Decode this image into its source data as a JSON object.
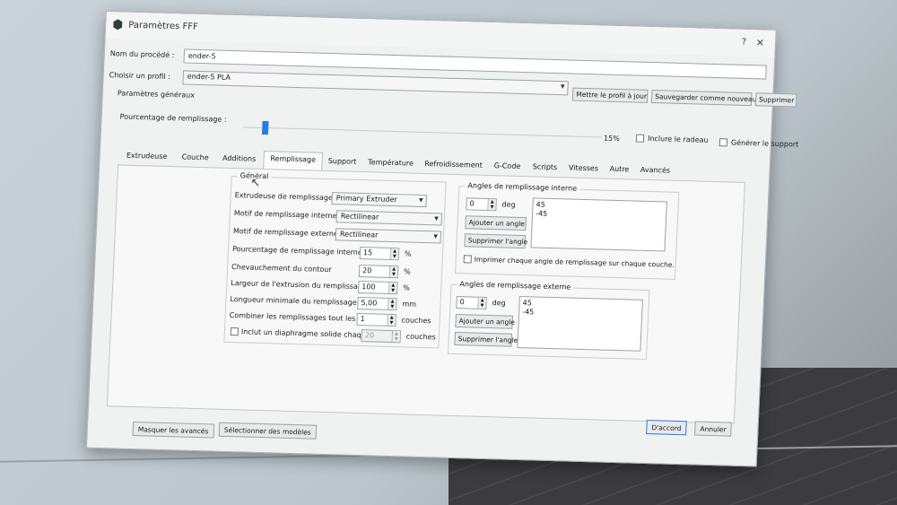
{
  "window": {
    "title": "Paramètres FFF",
    "help": "?",
    "close": "✕"
  },
  "process": {
    "label": "Nom du procédé :",
    "value": "ender-5"
  },
  "profile": {
    "label": "Choisir un profil :",
    "value": "ender-5 PLA",
    "update_btn": "Mettre le profil à jour",
    "save_new_btn": "Sauvegarder comme nouveau",
    "delete_btn": "Supprimer"
  },
  "general": {
    "title": "Paramètres généraux",
    "infill_label": "Pourcentage de remplissage :",
    "infill_value_text": "15%",
    "infill_fraction": 0.15,
    "raft_label": "Inclure le radeau",
    "support_label": "Générer le support"
  },
  "tabs": [
    "Extrudeuse",
    "Couche",
    "Additions",
    "Remplissage",
    "Support",
    "Température",
    "Refroidissement",
    "G-Code",
    "Scripts",
    "Vitesses",
    "Autre",
    "Avancés"
  ],
  "active_tab": "Remplissage",
  "infill": {
    "group_title": "Général",
    "extruder_label": "Extrudeuse de remplissage",
    "extruder_value": "Primary Extruder",
    "internal_pattern_label": "Motif de remplissage interne",
    "internal_pattern_value": "Rectilinear",
    "external_pattern_label": "Motif de remplissage externe",
    "external_pattern_value": "Rectilinear",
    "internal_pct_label": "Pourcentage de remplissage interne",
    "internal_pct_value": "15",
    "overlap_label": "Chevauchement du contour",
    "overlap_value": "20",
    "width_label": "Largeur de l'extrusion du remplissage",
    "width_value": "100",
    "min_length_label": "Longueur minimale du remplissage",
    "min_length_value": "5,00",
    "combine_label": "Combiner les remplissages tout les",
    "combine_value": "1",
    "diaphragm_label": "Inclut un diaphragme solide chaque",
    "diaphragm_value": "20",
    "unit_pct": "%",
    "unit_mm": "mm",
    "unit_layers": "couches"
  },
  "internal_angles": {
    "title": "Angles de remplissage interne",
    "value": "0",
    "unit": "deg",
    "add_btn": "Ajouter un angle",
    "remove_btn": "Supprimer l'angle",
    "list": [
      "45",
      "-45"
    ],
    "print_each_label": "Imprimer chaque angle de remplissage sur chaque couche."
  },
  "external_angles": {
    "title": "Angles de remplissage externe",
    "value": "0",
    "unit": "deg",
    "add_btn": "Ajouter un angle",
    "remove_btn": "Supprimer l'angle",
    "list": [
      "45",
      "-45"
    ]
  },
  "footer": {
    "hide_advanced": "Masquer les avancés",
    "select_models": "Sélectionner des modèles",
    "ok": "D'accord",
    "cancel": "Annuler"
  },
  "colors": {
    "accent": "#2a7be0"
  }
}
